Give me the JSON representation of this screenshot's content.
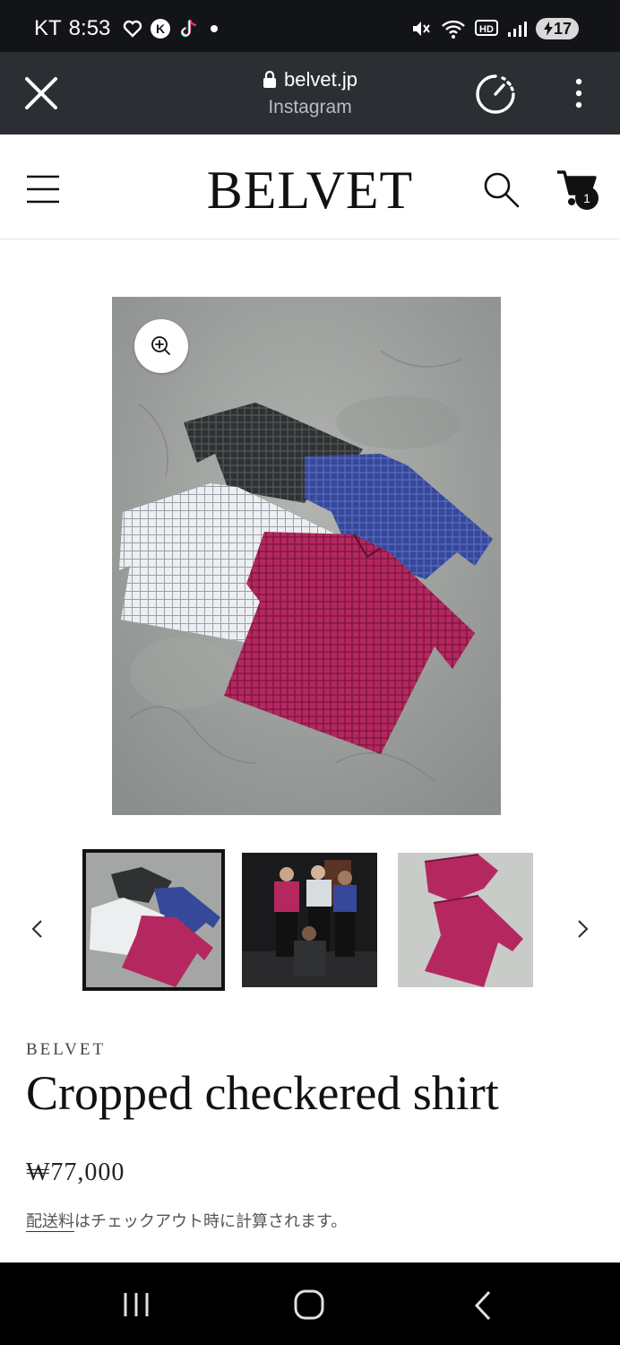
{
  "status_bar": {
    "carrier": "KT",
    "time": "8:53",
    "battery": "17",
    "icons": [
      "heart-outline-icon",
      "kakao-talk-icon",
      "tiktok-icon",
      "dot-icon",
      "mute-icon",
      "wifi-icon",
      "hd-icon",
      "signal-icon"
    ]
  },
  "browser": {
    "domain": "belvet.jp",
    "source": "Instagram"
  },
  "site_header": {
    "logo": "BELVET",
    "cart_count": "1"
  },
  "product": {
    "vendor": "BELVET",
    "title": "Cropped checkered shirt",
    "price": "₩77,000",
    "shipping_link": "配送料",
    "shipping_rest": "はチェックアウト時に計算されます。"
  },
  "gallery": {
    "thumbnails": [
      {
        "alt": "four checkered shirts",
        "selected": true
      },
      {
        "alt": "models wearing shirts",
        "selected": false
      },
      {
        "alt": "magenta shirts",
        "selected": false
      }
    ]
  },
  "colors": {
    "status_bg": "#121418",
    "browser_bg": "#2b2e33",
    "shirt_black": "#2f3133",
    "shirt_blue": "#35489a",
    "shirt_white": "#eceef0",
    "shirt_magenta": "#b5285f",
    "concrete": "#9fa2a0"
  }
}
